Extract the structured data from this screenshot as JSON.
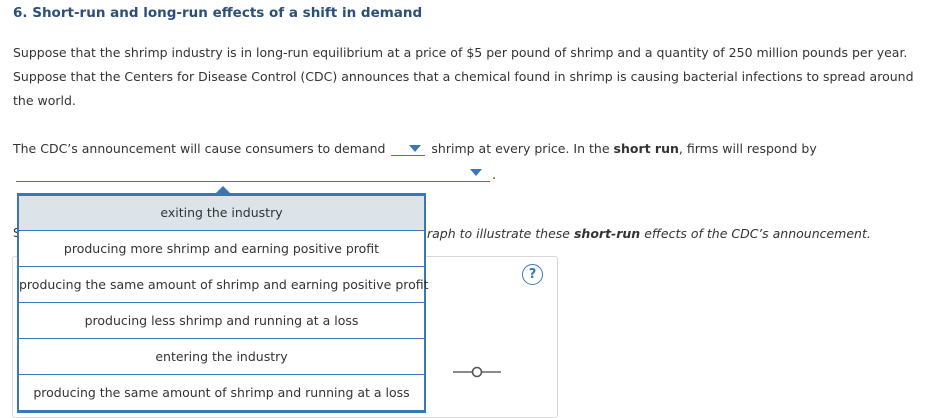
{
  "question": {
    "title": "6. Short-run and long-run effects of a shift in demand",
    "paragraph": "Suppose that the shrimp industry is in long-run equilibrium at a price of $5 per pound of shrimp and a quantity of 250 million pounds per year. Suppose that the Centers for Disease Control (CDC) announces that a chemical found in shrimp is causing bacterial infections to spread around the world.",
    "sentence_part1": "The CDC’s announcement will cause consumers to demand",
    "sentence_part2": "shrimp at every price. In the",
    "sentence_bold": "short run",
    "sentence_part3": ", firms will respond by",
    "period": ".",
    "instruction_fragment_start": "S",
    "instruction_visible": "raph to illustrate these",
    "instruction_bold": "short-run",
    "instruction_end": "effects of the CDC’s announcement.",
    "help_label": "?"
  },
  "dropdown_menu": {
    "items": [
      "exiting the industry",
      "producing more shrimp and earning positive profit",
      "producing the same amount of shrimp and earning positive profit",
      "producing less shrimp and running at a loss",
      "entering the industry",
      "producing the same amount of shrimp and running at a loss"
    ]
  },
  "colors": {
    "accent": "#3a78b5",
    "title": "#2a4f7a",
    "highlight": "#dde4e9"
  },
  "icons": {
    "dropdown": "chevron-down-icon",
    "help": "question-circle-icon",
    "handle": "line-handle-icon"
  }
}
